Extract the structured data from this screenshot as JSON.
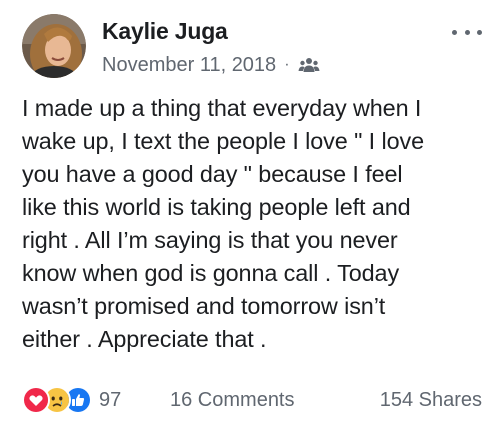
{
  "post": {
    "author": "Kaylie Juga",
    "date": "November 11, 2018",
    "separator": "·",
    "audience_icon": "group-icon",
    "more_icon": "more-dots-icon",
    "text": "I made up a thing that everyday when I\nwake up, I text the people I love \" I love\nyou have a good day \" because I feel\nlike this world is taking people left and\nright . All I’m saying is that you never\nknow when god is gonna call . Today\nwasn’t promised and tomorrow isn’t\neither . Appreciate that .",
    "reactions": {
      "icons": [
        "love-reaction-icon",
        "sad-reaction-icon",
        "like-reaction-icon"
      ],
      "count": "97"
    },
    "comments": "16 Comments",
    "shares": "154 Shares"
  },
  "colors": {
    "love": "#f0284a",
    "sad": "#f7c444",
    "like": "#1877f2",
    "meta_text": "#606770"
  }
}
